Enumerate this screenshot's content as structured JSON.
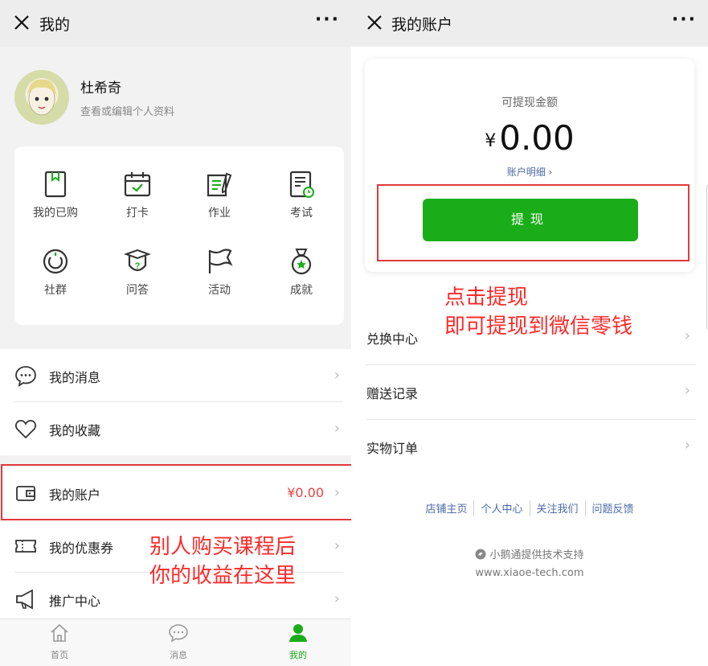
{
  "left": {
    "title": "我的",
    "more": "···",
    "profile": {
      "name": "杜希奇",
      "subtitle": "查看或编辑个人资料"
    },
    "grid": [
      {
        "label": "我的已购",
        "icon": "bookmark-book-icon"
      },
      {
        "label": "打卡",
        "icon": "calendar-check-icon"
      },
      {
        "label": "作业",
        "icon": "notebook-pen-icon"
      },
      {
        "label": "考试",
        "icon": "exam-paper-icon"
      },
      {
        "label": "社群",
        "icon": "community-ring-icon"
      },
      {
        "label": "问答",
        "icon": "question-cap-icon"
      },
      {
        "label": "活动",
        "icon": "flag-icon"
      },
      {
        "label": "成就",
        "icon": "medal-icon"
      }
    ],
    "menu1": [
      {
        "label": "我的消息",
        "icon": "chat-bubble-icon"
      },
      {
        "label": "我的收藏",
        "icon": "heart-icon"
      }
    ],
    "menu2": [
      {
        "label": "我的账户",
        "icon": "wallet-icon",
        "value": "¥0.00"
      },
      {
        "label": "我的优惠券",
        "icon": "coupon-icon"
      },
      {
        "label": "推广中心",
        "icon": "megaphone-icon"
      }
    ],
    "tabs": [
      {
        "label": "首页",
        "icon": "home-icon"
      },
      {
        "label": "消息",
        "icon": "message-icon"
      },
      {
        "label": "我的",
        "icon": "person-icon",
        "active": true
      }
    ],
    "annotation": [
      "别人购买课程后",
      "你的收益在这里"
    ]
  },
  "right": {
    "title": "我的账户",
    "more": "···",
    "balance": {
      "label": "可提现金额",
      "currency": "¥",
      "amount": "0.00",
      "detail": "账户明细 ›"
    },
    "withdraw_label": "提现",
    "annotation": [
      "点击提现",
      "即可提现到微信零钱"
    ],
    "list": [
      {
        "label": "兑换中心"
      },
      {
        "label": "赠送记录"
      },
      {
        "label": "实物订单"
      }
    ],
    "links": [
      "店铺主页",
      "个人中心",
      "关注我们",
      "问题反馈"
    ],
    "powered": "小鹅通提供技术支持",
    "site": "www.xiaoe-tech.com"
  },
  "colors": {
    "accent": "#1aad19",
    "annotation": "#ff2a2a",
    "link": "#4c6aa8"
  }
}
